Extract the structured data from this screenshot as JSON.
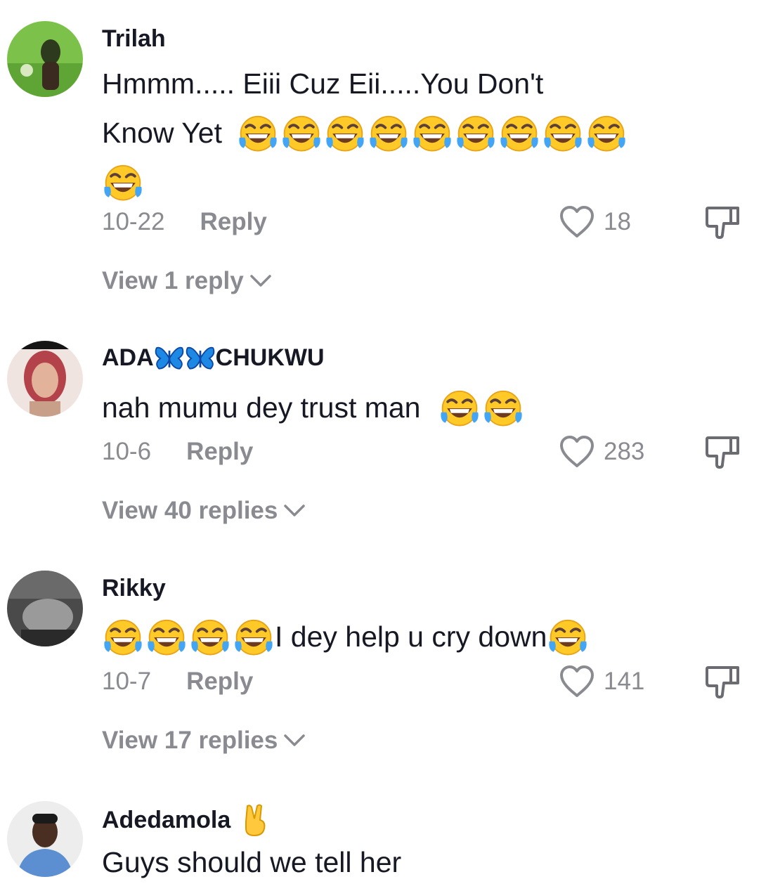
{
  "comments": [
    {
      "username": "Trilah",
      "text_line1": "Hmmm..... Eiii Cuz Eii.....You Don't",
      "text_line2": "Know Yet",
      "emoji_count": 10,
      "date": "10-22",
      "reply_label": "Reply",
      "likes": "18",
      "view_replies": "View 1 reply",
      "avatar_colors": [
        "#7cc24a",
        "#3f7d28"
      ]
    },
    {
      "username_part1": "ADA",
      "username_part2": "CHUKWU",
      "text": "nah mumu dey trust man",
      "emoji_count": 2,
      "date": "10-6",
      "reply_label": "Reply",
      "likes": "283",
      "view_replies": "View 40 replies",
      "avatar_colors": [
        "#f3e6e2",
        "#b8494d"
      ]
    },
    {
      "username": "Rikky",
      "text": "I dey help u cry down",
      "emoji_count_before": 4,
      "emoji_count_after": 1,
      "date": "10-7",
      "reply_label": "Reply",
      "likes": "141",
      "view_replies": "View 17 replies",
      "avatar_colors": [
        "#5d5d5d",
        "#2e2e2e"
      ]
    },
    {
      "username": "Adedamola",
      "text": "Guys should we tell her",
      "avatar_colors": [
        "#eeeeee",
        "#4a7fc1"
      ]
    }
  ],
  "icons": {
    "like": "heart-outline-icon",
    "dislike": "thumbs-down-icon",
    "expand": "chevron-down-icon",
    "emoji_laugh": "tears-of-joy-emoji",
    "emoji_peace": "victory-hand-emoji",
    "emoji_butterfly": "butterfly-emoji"
  },
  "colors": {
    "text": "#161823",
    "muted": "#8a8b91",
    "background": "#ffffff"
  }
}
